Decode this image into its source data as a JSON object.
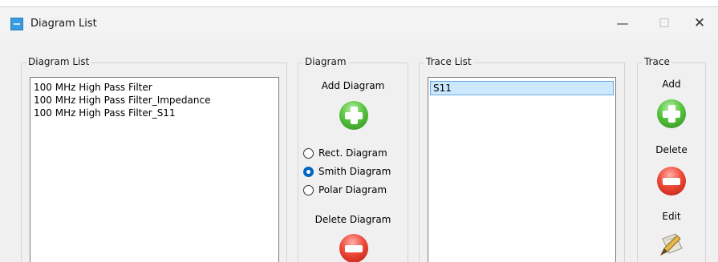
{
  "window": {
    "title": "Diagram List",
    "minimize": "—",
    "maximize": "☐",
    "close": "✕"
  },
  "diagram_list": {
    "group_label": "Diagram List",
    "items": [
      "100 MHz High Pass Filter",
      "100 MHz High Pass Filter_Impedance",
      "100 MHz High Pass Filter_S11"
    ]
  },
  "diagram": {
    "group_label": "Diagram",
    "add_label": "Add Diagram",
    "options": [
      "Rect. Diagram",
      "Smith Diagram",
      "Polar Diagram"
    ],
    "selected_option": "Smith Diagram",
    "delete_label": "Delete Diagram"
  },
  "trace_list": {
    "group_label": "Trace List",
    "items": [
      "S11"
    ],
    "selected": "S11"
  },
  "trace": {
    "group_label": "Trace",
    "add_label": "Add",
    "delete_label": "Delete",
    "edit_label": "Edit"
  },
  "colors": {
    "add_green": "#57c43e",
    "delete_red": "#ee4a3a",
    "selection_blue": "#cce8ff",
    "radio_blue": "#0067c0"
  }
}
